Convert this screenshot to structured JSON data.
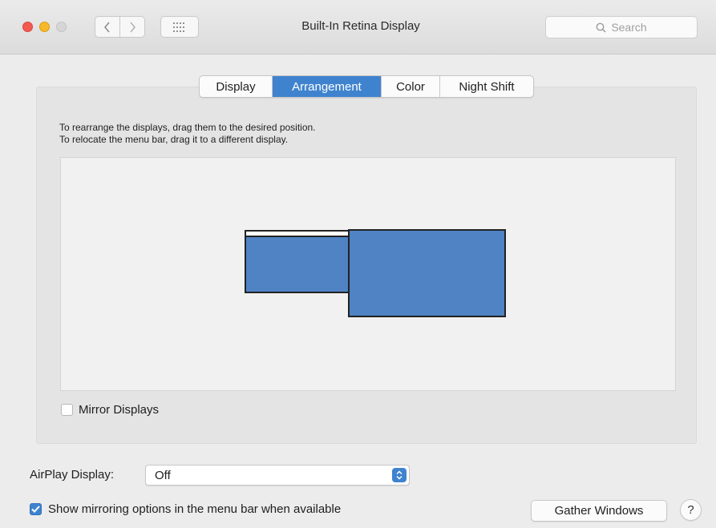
{
  "window": {
    "title": "Built-In Retina Display"
  },
  "toolbar": {
    "search_placeholder": "Search",
    "back_icon": "chevron-left-icon",
    "forward_icon": "chevron-right-icon",
    "grid_icon": "grid-icon"
  },
  "tabs": [
    {
      "label": "Display",
      "active": false
    },
    {
      "label": "Arrangement",
      "active": true
    },
    {
      "label": "Color",
      "active": false
    },
    {
      "label": "Night Shift",
      "active": false
    }
  ],
  "instructions": {
    "line1": "To rearrange the displays, drag them to the desired position.",
    "line2": "To relocate the menu bar, drag it to a different display."
  },
  "mirror_displays": {
    "label": "Mirror Displays",
    "checked": false
  },
  "airplay": {
    "label": "AirPlay Display:",
    "value": "Off"
  },
  "show_mirroring": {
    "label": "Show mirroring options in the menu bar when available",
    "checked": true
  },
  "buttons": {
    "gather_windows": "Gather Windows",
    "help": "?"
  },
  "colors": {
    "accent": "#3f83cf",
    "display_fill": "#4f83c4"
  }
}
